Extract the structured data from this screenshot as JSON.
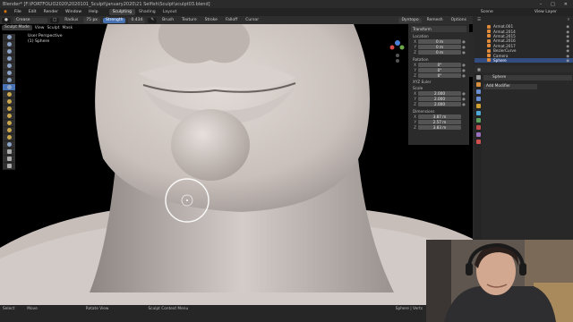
{
  "titlebar": {
    "text": "Blender* [F:\\PORTFOLIO2020\\2020101_Sculpt\\january2020\\21 Selfish\\Sculpt\\sculpt03.blend]",
    "controls": [
      "–",
      "□",
      "✕"
    ]
  },
  "menubar": {
    "items": [
      "File",
      "Edit",
      "Render",
      "Window",
      "Help"
    ],
    "workspaces": [
      "Sculpting",
      "Shading",
      "Layout"
    ],
    "active_workspace": "Sculpting",
    "scene_label": "Scene",
    "view_layer_label": "View Layer"
  },
  "toolheader": {
    "brush_name": "Crease",
    "radius_label": "Radius",
    "radius_value": "75 px",
    "strength_label": "Strength",
    "strength_value": "0.434",
    "brush_menu": "Brush",
    "texture_menu": "Texture",
    "stroke_menu": "Stroke",
    "falloff_menu": "Falloff",
    "cursor_menu": "Cursor",
    "dyntopo": "Dyntopo",
    "remesh": "Remesh",
    "options": "Options"
  },
  "mode_row": {
    "mode": "Sculpt Mode",
    "view_menu": "View",
    "sculpt_menu": "Sculpt",
    "mask_menu": "Mask"
  },
  "viewport": {
    "view_name": "User Perspective",
    "object_name": "(1) Sphere"
  },
  "npanel": {
    "header": "Transform",
    "location_label": "Location",
    "location": [
      {
        "axis": "X",
        "value": "0 m"
      },
      {
        "axis": "Y",
        "value": "0 m"
      },
      {
        "axis": "Z",
        "value": "0 m"
      }
    ],
    "rotation_label": "Rotation",
    "rotation": [
      {
        "axis": "X",
        "value": "0°"
      },
      {
        "axis": "Y",
        "value": "0°"
      },
      {
        "axis": "Z",
        "value": "0°"
      }
    ],
    "rotation_mode": "XYZ Euler",
    "scale_label": "Scale",
    "scale": [
      {
        "axis": "X",
        "value": "2.000"
      },
      {
        "axis": "Y",
        "value": "2.000"
      },
      {
        "axis": "Z",
        "value": "2.000"
      }
    ],
    "dimensions_label": "Dimensions",
    "dimensions": [
      {
        "axis": "X",
        "value": "3.87 m"
      },
      {
        "axis": "Y",
        "value": "2.57 m"
      },
      {
        "axis": "Z",
        "value": "3.83 m"
      }
    ]
  },
  "outliner": {
    "rows": [
      {
        "name": "Armat.001",
        "selected": false
      },
      {
        "name": "Armat.2014",
        "selected": false
      },
      {
        "name": "Armat.2015",
        "selected": false
      },
      {
        "name": "Armat.2016",
        "selected": false
      },
      {
        "name": "Armat.2017",
        "selected": false
      },
      {
        "name": "BezierCurve",
        "selected": false
      },
      {
        "name": "Camera",
        "selected": false
      },
      {
        "name": "Sphere",
        "selected": true
      }
    ]
  },
  "properties": {
    "object_name": "Sphere",
    "add_modifier": "Add Modifier",
    "tab_colors": [
      "#9a9a9a",
      "#d89040",
      "#6a8fd0",
      "#6a8fd0",
      "#d0a030",
      "#4fa8d8",
      "#5ea05e",
      "#c44a4a",
      "#9a70c0",
      "#d05050"
    ]
  },
  "statusbar": {
    "select": "Select",
    "move": "Move",
    "rotate_view": "Rotate View",
    "context_menu": "Sculpt Context Menu",
    "stats": "Sphere | Verts"
  },
  "colors": {
    "accent": "#4772b3",
    "skin": "#cfc6c2",
    "header_bg": "#2e2e2e",
    "selected_row": "#334d80"
  }
}
